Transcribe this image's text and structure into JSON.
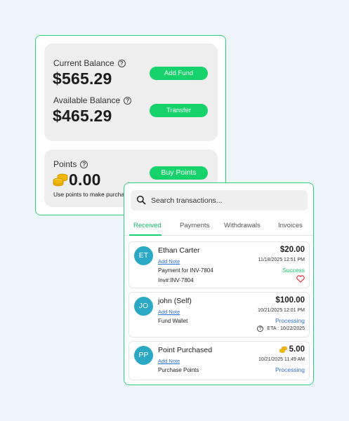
{
  "wallet": {
    "current_balance_label": "Current Balance",
    "current_balance": "$565.29",
    "add_fund_label": "Add Fund",
    "available_balance_label": "Available Balance",
    "available_balance": "$465.29",
    "transfer_label": "Transfer",
    "points_label": "Points",
    "points_value": "0.00",
    "buy_points_label": "Buy Points",
    "points_description": "Use points to make purchases"
  },
  "transactions": {
    "search_placeholder": "Search transactions...",
    "tabs": [
      {
        "label": "Received",
        "active": true
      },
      {
        "label": "Payments",
        "active": false
      },
      {
        "label": "Withdrawals",
        "active": false
      },
      {
        "label": "Invoices",
        "active": false
      }
    ],
    "items": [
      {
        "initials": "ET",
        "name": "Ethan Carter",
        "note_link": "Add Note",
        "description": "Payment for INV-7804",
        "reference": "Inv#:INV-7804",
        "amount": "$20.00",
        "datetime": "11/18/2025 12:51 PM",
        "status": "Success"
      },
      {
        "initials": "JO",
        "name": "john (Self)",
        "note_link": "Add Note",
        "description": "Fund Wallet",
        "amount": "$100.00",
        "datetime": "10/21/2025 12:01 PM",
        "status": "Processing",
        "eta": "ETA : 10/22/2025"
      },
      {
        "initials": "PP",
        "name": "Point Purchased",
        "note_link": "Add Note",
        "description": "Purchase Points",
        "amount": "5.00",
        "datetime": "10/21/2025 11:49 AM",
        "status": "Processing"
      }
    ]
  },
  "colors": {
    "accent_green": "#16d26b",
    "avatar": "#2ba8c3",
    "link_blue": "#2d6fd6",
    "heart_red": "#e0333b",
    "coin_gold": "#f2b705"
  },
  "icons": [
    "help-circle-icon",
    "coins-icon",
    "search-icon",
    "heart-icon"
  ]
}
